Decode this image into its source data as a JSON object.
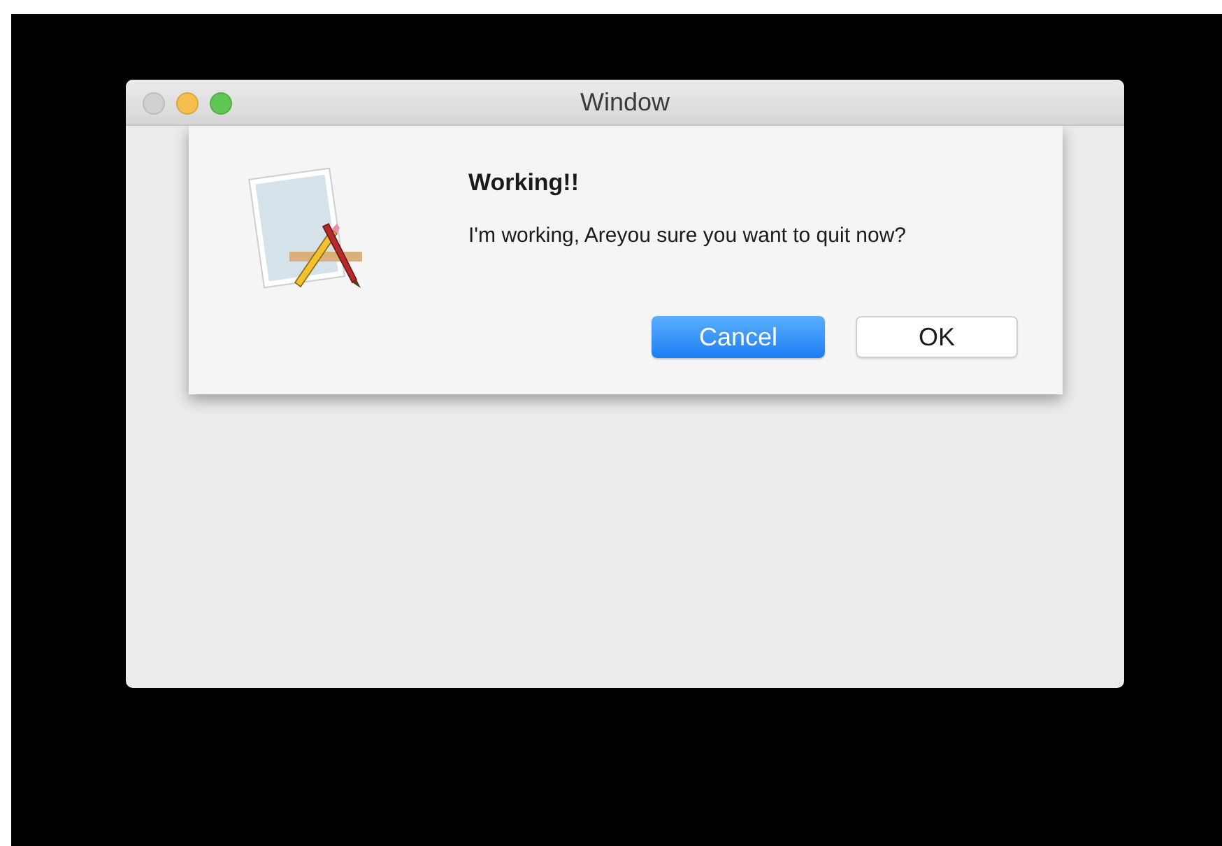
{
  "window": {
    "title": "Window",
    "controls": [
      {
        "kind": "close",
        "disabled": true
      },
      {
        "kind": "minimize",
        "disabled": false
      },
      {
        "kind": "zoom",
        "disabled": false
      }
    ]
  },
  "alert": {
    "title": "Working!!",
    "message": "I'm working, Areyou sure you want to quit now?",
    "buttons": [
      {
        "label": "Cancel",
        "default": true
      },
      {
        "label": "OK",
        "default": false
      }
    ]
  }
}
